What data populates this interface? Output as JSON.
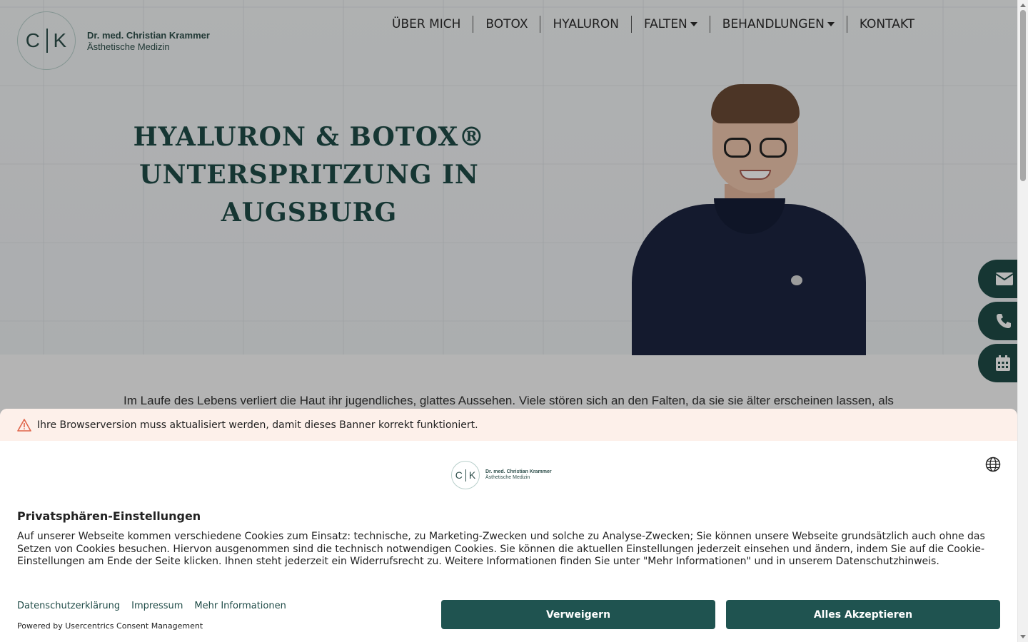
{
  "brand": {
    "monogram_left": "C",
    "monogram_right": "K",
    "name": "Dr. med. Christian Krammer",
    "subtitle": "Ästhetische Medizin"
  },
  "nav": {
    "items": [
      {
        "label": "ÜBER MICH",
        "dropdown": false
      },
      {
        "label": "BOTOX",
        "dropdown": false
      },
      {
        "label": "HYALURON",
        "dropdown": false
      },
      {
        "label": "FALTEN",
        "dropdown": true
      },
      {
        "label": "BEHANDLUNGEN",
        "dropdown": true
      },
      {
        "label": "KONTAKT",
        "dropdown": false
      }
    ]
  },
  "hero": {
    "title_line1": "HYALURON & BOTOX®",
    "title_line2": "UNTERSPRITZUNG IN",
    "title_line3": "AUGSBURG"
  },
  "intro": {
    "text": "Im Laufe des Lebens verliert die Haut ihr jugendliches, glattes Aussehen. Viele stören sich an den Falten, da sie sie älter erscheinen lassen, als"
  },
  "side_buttons": [
    {
      "icon": "envelope-icon"
    },
    {
      "icon": "phone-icon"
    },
    {
      "icon": "calendar-icon"
    }
  ],
  "consent": {
    "warning": "Ihre Browserversion muss aktualisiert werden, damit dieses Banner korrekt funktioniert.",
    "logo_name": "Dr. med. Christian Krammer",
    "logo_sub": "Ästhetische Medizin",
    "title": "Privatsphären-Einstellungen",
    "body": "Auf unserer Webseite kommen verschiedene Cookies zum Einsatz: technische, zu Marketing-Zwecken und solche zu Analyse-Zwecken; Sie können unsere Webseite grundsätzlich auch ohne das Setzen von Cookies besuchen. Hiervon ausgenommen sind die technisch notwendigen Cookies. Sie können die aktuellen Einstellungen jederzeit einsehen und ändern, indem Sie auf die Cookie-Einstellungen am Ende der Seite klicken. Ihnen steht jederzeit ein Widerrufsrecht zu. Weitere Informationen finden Sie unter \"Mehr Informationen\" und in unserem Datenschutzhinweis.",
    "links": [
      "Datenschutzerklärung",
      "Impressum",
      "Mehr Informationen"
    ],
    "powered": "Powered by Usercentrics Consent Management",
    "deny_label": "Verweigern",
    "accept_label": "Alles Akzeptieren"
  },
  "colors": {
    "brand_green": "#1f4b47",
    "button_green": "#1f5350",
    "warning_bg": "#fdf0ea",
    "warning_icon": "#e0654a"
  }
}
